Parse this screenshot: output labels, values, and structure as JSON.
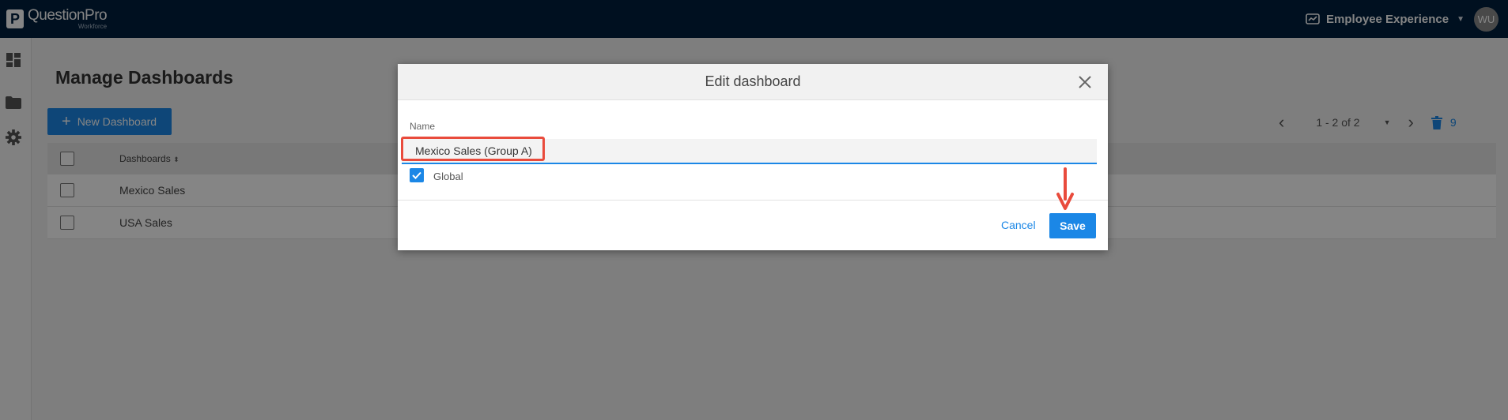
{
  "app": {
    "logo_letter": "P",
    "logo_name": "QuestionPro",
    "logo_sub": "Workforce",
    "product_label": "Employee Experience",
    "user_initials": "WU"
  },
  "page": {
    "title": "Manage Dashboards",
    "new_button": "New Dashboard",
    "pagination": "1 - 2 of 2",
    "trash_count": "9",
    "table": {
      "column_header": "Dashboards",
      "rows": [
        "Mexico Sales",
        "USA Sales"
      ]
    }
  },
  "dialog": {
    "title": "Edit dashboard",
    "name_label": "Name",
    "name_value": "Mexico Sales (Group A)",
    "global_label": "Global",
    "cancel_label": "Cancel",
    "save_label": "Save"
  },
  "colors": {
    "topbar": "#00203f",
    "primary": "#1b87e6",
    "highlight": "#e94b3c"
  }
}
